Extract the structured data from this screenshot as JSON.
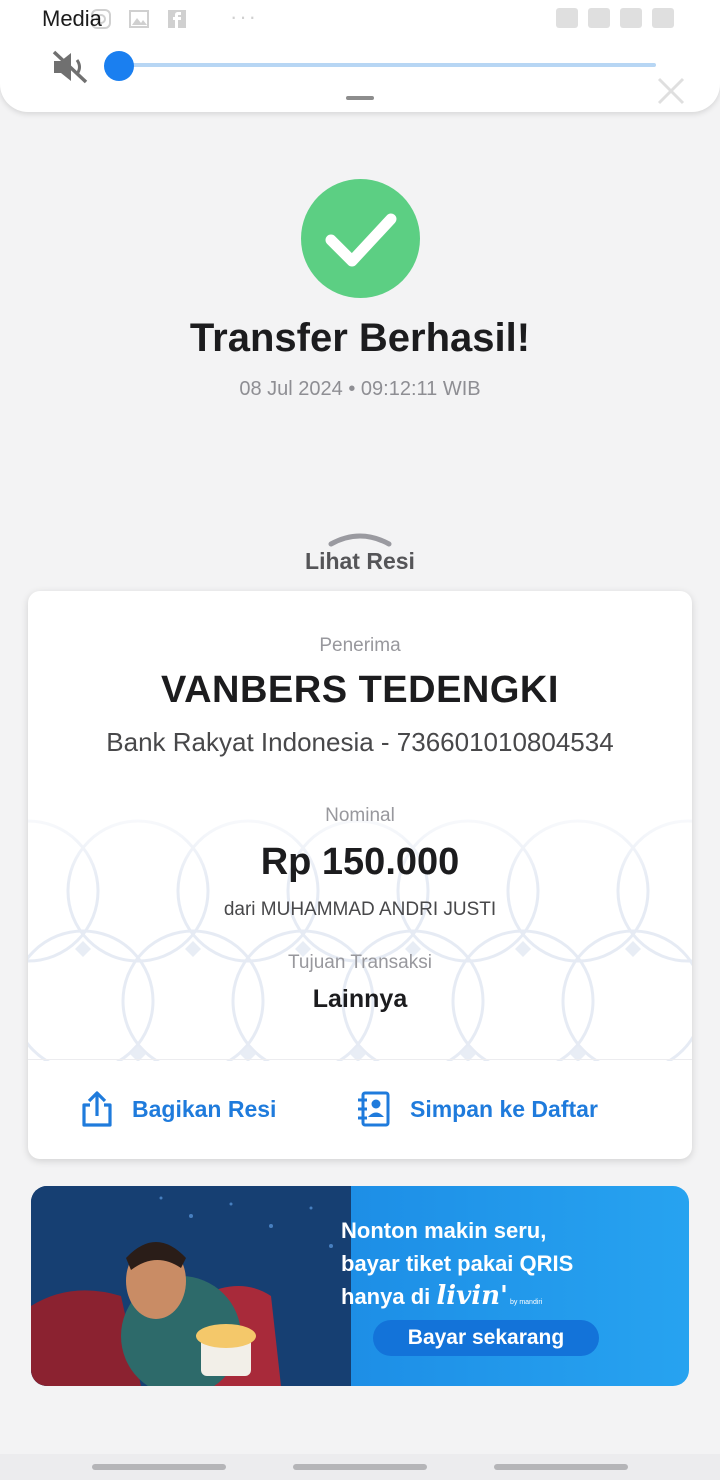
{
  "media_panel": {
    "label": "Media",
    "volume_level": 0.0,
    "icons": [
      "mute-icon",
      "instagram-icon",
      "gallery-icon",
      "facebook-icon",
      "more-icon"
    ],
    "more": "···"
  },
  "status": {
    "title": "Transfer Berhasil!",
    "datetime": "08 Jul 2024 • 09:12:11 WIB",
    "success_color": "#5ccf83"
  },
  "receipt": {
    "toggle_label": "Lihat Resi",
    "recipient_label": "Penerima",
    "recipient_name": "VANBERS TEDENGKI",
    "recipient_bank": "Bank Rakyat Indonesia - 736601010804534",
    "amount_label": "Nominal",
    "amount": "Rp 150.000",
    "from": "dari MUHAMMAD ANDRI JUSTI",
    "purpose_label": "Tujuan Transaksi",
    "purpose": "Lainnya",
    "share_label": "Bagikan Resi",
    "save_label": "Simpan ke Daftar",
    "accent_color": "#1f7bdc"
  },
  "banner": {
    "line1": "Nonton makin seru,",
    "line2": "bayar tiket pakai QRIS",
    "line3": "hanya di",
    "logo": "livin'",
    "logo_sub": "by mandiri",
    "button": "Bayar sekarang"
  }
}
